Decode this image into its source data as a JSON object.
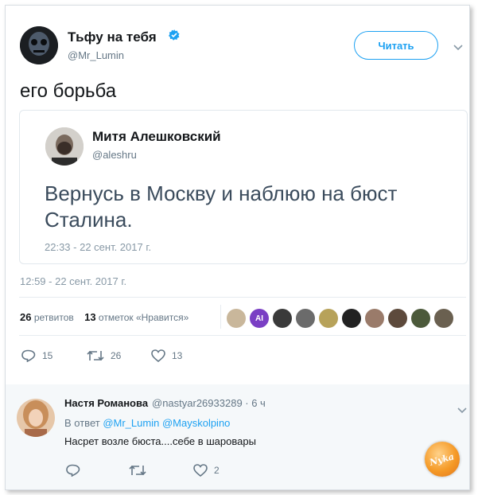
{
  "tweet": {
    "author_name": "Тьфу на тебя",
    "author_handle": "@Mr_Lumin",
    "follow_label": "Читать",
    "text": "его борьба",
    "timestamp": "12:59 - 22 сент. 2017 г.",
    "retweets_count": "26",
    "retweets_label": "ретвитов",
    "likes_count": "13",
    "likes_label": "отметок «Нравится»"
  },
  "quote": {
    "author_name": "Митя Алешковский",
    "author_handle": "@aleshru",
    "text": "Вернусь в Москву и наблюю на бюст Сталина.",
    "timestamp": "22:33 - 22 сент. 2017 г."
  },
  "actions": {
    "reply_count": "15",
    "retweet_count": "26",
    "like_count": "13"
  },
  "likers": [
    {
      "initials": "",
      "color": "#c9b79b"
    },
    {
      "initials": "AI",
      "color": "#7a3fc4"
    },
    {
      "initials": "",
      "color": "#3a3a3a"
    },
    {
      "initials": "",
      "color": "#6b6b6b"
    },
    {
      "initials": "",
      "color": "#b7a25a"
    },
    {
      "initials": "",
      "color": "#222222"
    },
    {
      "initials": "",
      "color": "#9a7b6a"
    },
    {
      "initials": "",
      "color": "#5d4a3c"
    },
    {
      "initials": "",
      "color": "#4c5a3b"
    },
    {
      "initials": "",
      "color": "#6a6050"
    }
  ],
  "reply": {
    "author_name": "Настя Романова",
    "meta": "@nastyar26933289 · 6 ч",
    "reply_to_prefix": "В ответ",
    "reply_to_1": "@Mr_Lumin",
    "reply_to_2": "@Mayskolpino",
    "text": "Насрет возле бюста....себе в шаровары",
    "like_count": "2"
  },
  "watermark": "Nyka",
  "colors": {
    "accent": "#1da1f2",
    "muted": "#657786",
    "verified": "#1da1f2",
    "reply_bg": "#f5f8fa"
  }
}
